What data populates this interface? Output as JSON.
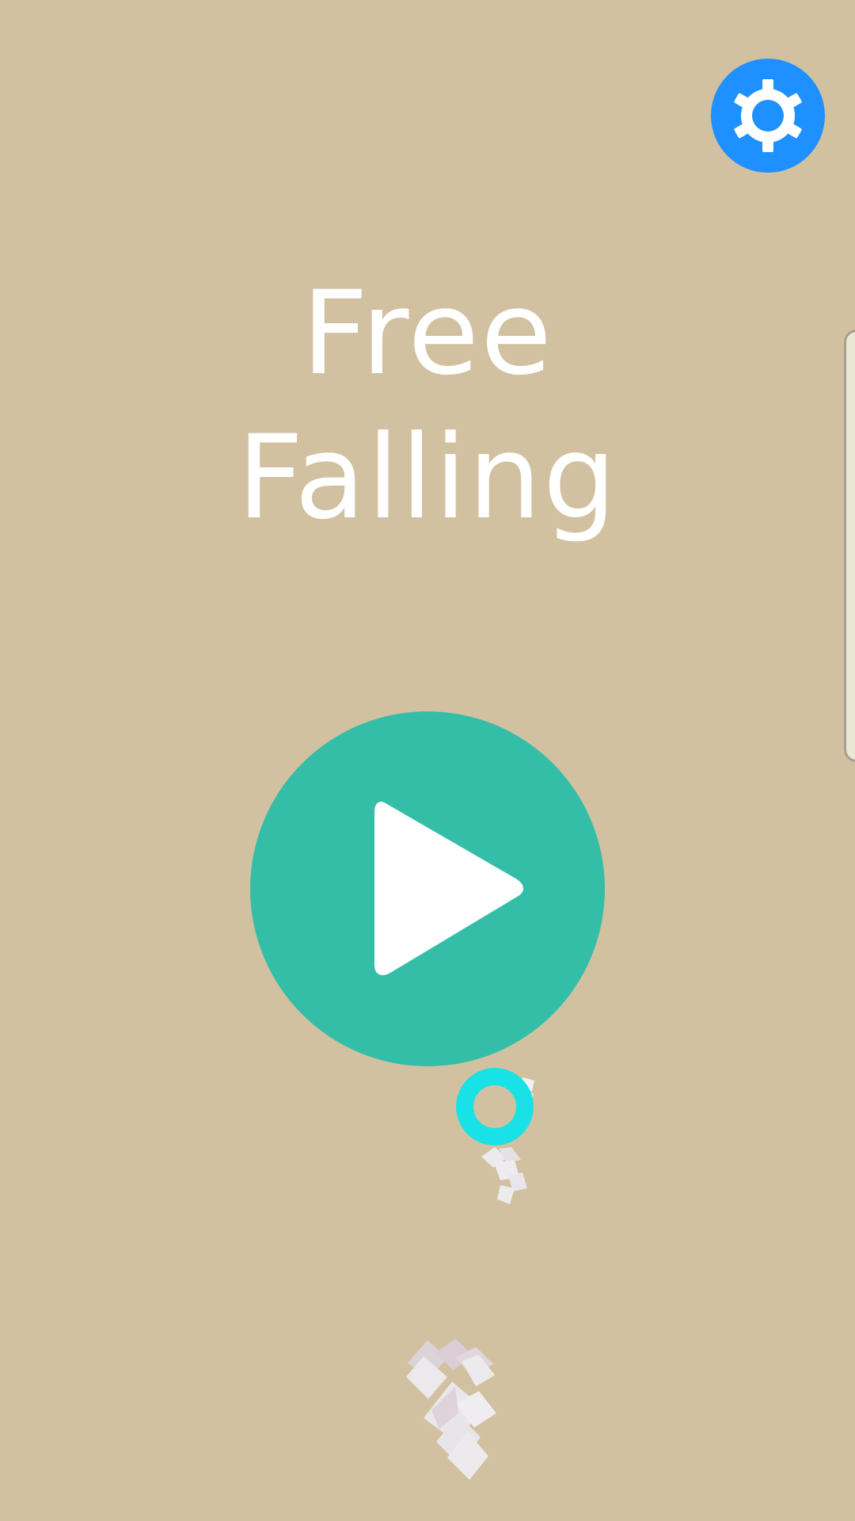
{
  "game": {
    "title_line1": "Free",
    "title_line2": "Falling"
  },
  "icons": {
    "settings": "gear-icon",
    "play": "play-icon",
    "player": "ring-player",
    "debris": "falling-blocks"
  },
  "colors": {
    "background": "#d2c1a0",
    "settings_button": "#1e90ff",
    "play_button": "#34bea8",
    "title_text": "#ffffff",
    "player_ring": "#19e2e6",
    "blocks": "#eceaed"
  }
}
